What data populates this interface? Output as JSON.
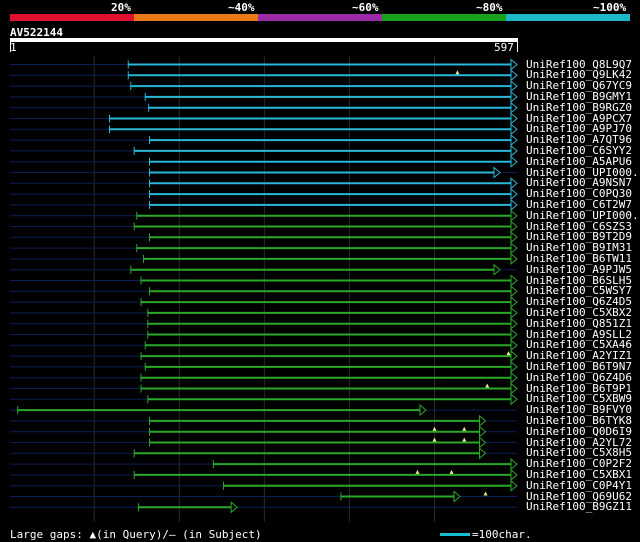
{
  "legend": {
    "items": [
      {
        "label": "20%",
        "color": "#e0102f"
      },
      {
        "label": "~40%",
        "color": "#e87a1a"
      },
      {
        "label": "~60%",
        "color": "#9b2aa8"
      },
      {
        "label": "~80%",
        "color": "#1aa11a"
      },
      {
        "label": "~100%",
        "color": "#1ab8c8"
      }
    ]
  },
  "query": {
    "name": "AV522144",
    "start": "1",
    "end": "597"
  },
  "colors": {
    "cyan": "#28b8d8",
    "green": "#2aa82a",
    "dim": "#0a1f55",
    "grid": "#2a2a2a",
    "gap_marker": "#f0e68c"
  },
  "hits": [
    {
      "label": "UniRef100_Q8L9Q7",
      "color": "cyan",
      "start": 140,
      "end": 597,
      "gaps": []
    },
    {
      "label": "UniRef100_Q9LK42",
      "color": "cyan",
      "start": 140,
      "end": 597,
      "gaps": [
        527
      ]
    },
    {
      "label": "UniRef100_Q67YC9",
      "color": "cyan",
      "start": 143,
      "end": 597,
      "gaps": []
    },
    {
      "label": "UniRef100_B9GMY1",
      "color": "cyan",
      "start": 160,
      "end": 597,
      "gaps": []
    },
    {
      "label": "UniRef100_B9RGZ0",
      "color": "cyan",
      "start": 164,
      "end": 597,
      "gaps": []
    },
    {
      "label": "UniRef100_A9PCX7",
      "color": "cyan",
      "start": 118,
      "end": 597,
      "gaps": []
    },
    {
      "label": "UniRef100_A9PJ70",
      "color": "cyan",
      "start": 118,
      "end": 597,
      "gaps": []
    },
    {
      "label": "UniRef100_A7QT96",
      "color": "cyan",
      "start": 165,
      "end": 597,
      "gaps": []
    },
    {
      "label": "UniRef100_C6SYY2",
      "color": "cyan",
      "start": 147,
      "end": 597,
      "gaps": []
    },
    {
      "label": "UniRef100_A5APU6",
      "color": "cyan",
      "start": 165,
      "end": 597,
      "gaps": []
    },
    {
      "label": "UniRef100_UPI000..",
      "color": "cyan",
      "start": 165,
      "end": 577,
      "gaps": []
    },
    {
      "label": "UniRef100_A9NSN7",
      "color": "cyan",
      "start": 165,
      "end": 597,
      "gaps": []
    },
    {
      "label": "UniRef100_C0PQ30",
      "color": "cyan",
      "start": 165,
      "end": 597,
      "gaps": []
    },
    {
      "label": "UniRef100_C6T2W7",
      "color": "cyan",
      "start": 165,
      "end": 597,
      "gaps": []
    },
    {
      "label": "UniRef100_UPI000..",
      "color": "green",
      "start": 150,
      "end": 597,
      "gaps": []
    },
    {
      "label": "UniRef100_C6SZS3",
      "color": "green",
      "start": 147,
      "end": 597,
      "gaps": []
    },
    {
      "label": "UniRef100_B9T2D9",
      "color": "green",
      "start": 165,
      "end": 597,
      "gaps": []
    },
    {
      "label": "UniRef100_B9IM31",
      "color": "green",
      "start": 150,
      "end": 597,
      "gaps": []
    },
    {
      "label": "UniRef100_B6TW11",
      "color": "green",
      "start": 158,
      "end": 597,
      "gaps": []
    },
    {
      "label": "UniRef100_A9PJW5",
      "color": "green",
      "start": 143,
      "end": 577,
      "gaps": []
    },
    {
      "label": "UniRef100_B6SLH5",
      "color": "green",
      "start": 155,
      "end": 597,
      "gaps": []
    },
    {
      "label": "UniRef100_C5WSY7",
      "color": "green",
      "start": 165,
      "end": 597,
      "gaps": []
    },
    {
      "label": "UniRef100_Q6Z4D5",
      "color": "green",
      "start": 155,
      "end": 597,
      "gaps": []
    },
    {
      "label": "UniRef100_C5XBX2",
      "color": "green",
      "start": 163,
      "end": 597,
      "gaps": []
    },
    {
      "label": "UniRef100_Q851Z1",
      "color": "green",
      "start": 163,
      "end": 597,
      "gaps": []
    },
    {
      "label": "UniRef100_A9SLL2",
      "color": "green",
      "start": 163,
      "end": 597,
      "gaps": []
    },
    {
      "label": "UniRef100_C5XA46",
      "color": "green",
      "start": 160,
      "end": 597,
      "gaps": []
    },
    {
      "label": "UniRef100_A2YIZ1",
      "color": "green",
      "start": 155,
      "end": 597,
      "gaps": [
        587
      ]
    },
    {
      "label": "UniRef100_B6T9N7",
      "color": "green",
      "start": 160,
      "end": 597,
      "gaps": []
    },
    {
      "label": "UniRef100_Q6Z4D6",
      "color": "green",
      "start": 155,
      "end": 597,
      "gaps": []
    },
    {
      "label": "UniRef100_B6T9P1",
      "color": "green",
      "start": 155,
      "end": 597,
      "gaps": [
        562
      ]
    },
    {
      "label": "UniRef100_C5XBW9",
      "color": "green",
      "start": 163,
      "end": 597,
      "gaps": []
    },
    {
      "label": "UniRef100_B9FVY0",
      "color": "green",
      "start": 10,
      "end": 490,
      "gaps": []
    },
    {
      "label": "UniRef100_B6TYK8",
      "color": "green",
      "start": 165,
      "end": 560,
      "gaps": []
    },
    {
      "label": "UniRef100_Q0D6I9",
      "color": "green",
      "start": 165,
      "end": 560,
      "gaps": [
        500,
        535
      ]
    },
    {
      "label": "UniRef100_A2YL72",
      "color": "green",
      "start": 165,
      "end": 560,
      "gaps": [
        500,
        535
      ]
    },
    {
      "label": "UniRef100_C5X8H5",
      "color": "green",
      "start": 147,
      "end": 560,
      "gaps": []
    },
    {
      "label": "UniRef100_C0P2F2",
      "color": "green",
      "start": 240,
      "end": 597,
      "gaps": []
    },
    {
      "label": "UniRef100_C5XBX1",
      "color": "green",
      "start": 147,
      "end": 597,
      "gaps": [
        480,
        520
      ]
    },
    {
      "label": "UniRef100_C0P4Y1",
      "color": "green",
      "start": 252,
      "end": 597,
      "gaps": []
    },
    {
      "label": "UniRef100_Q69U62",
      "color": "green",
      "start": 390,
      "end": 530,
      "gaps": [
        560
      ]
    },
    {
      "label": "UniRef100_B9GZ11",
      "color": "green",
      "start": 152,
      "end": 268,
      "gaps": []
    }
  ],
  "footer": {
    "gaps_text": "Large gaps: ▲(in Query)/– (in Subject)",
    "scale_text": "=100char."
  }
}
